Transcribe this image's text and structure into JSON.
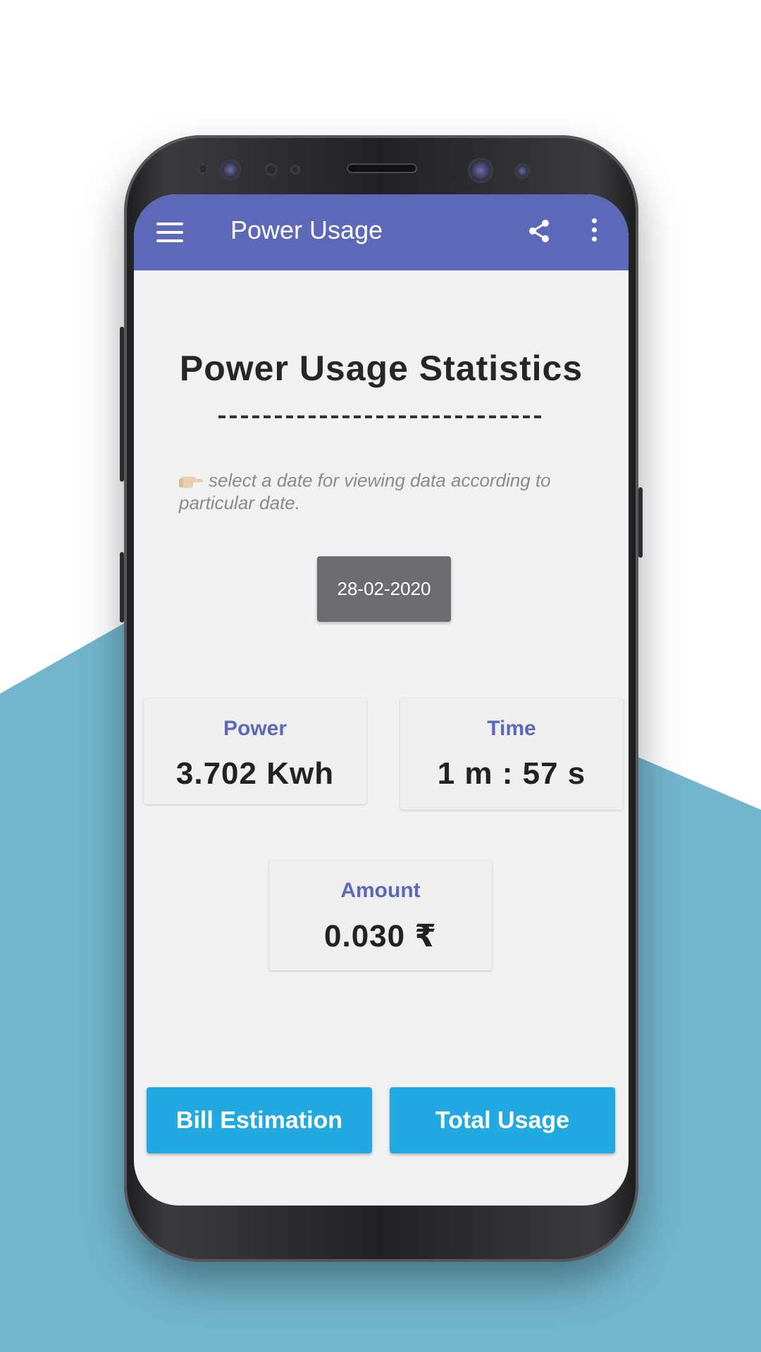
{
  "colors": {
    "backdrop": "#72b5cc",
    "appbar": "#5b69b8",
    "accent_label": "#5b69b8",
    "action_button": "#23a9e1",
    "date_button": "#6a6c70",
    "screen_bg": "#f1f1f2"
  },
  "appbar": {
    "title": "Power Usage",
    "menu_icon": "hamburger-menu-icon",
    "share_icon": "share-icon",
    "more_icon": "more-vert-icon"
  },
  "main": {
    "heading": "Power Usage Statistics",
    "hint_icon": "pointing-hand-icon",
    "hint": "select a date for viewing data according to particular date.",
    "date": "28-02-2020",
    "cards": {
      "power": {
        "label": "Power",
        "value": "3.702 Kwh"
      },
      "time": {
        "label": "Time",
        "value": "1 m : 57 s"
      },
      "amount": {
        "label": "Amount",
        "value": "0.030 ₹"
      }
    }
  },
  "actions": {
    "bill": "Bill Estimation",
    "total": "Total Usage"
  }
}
